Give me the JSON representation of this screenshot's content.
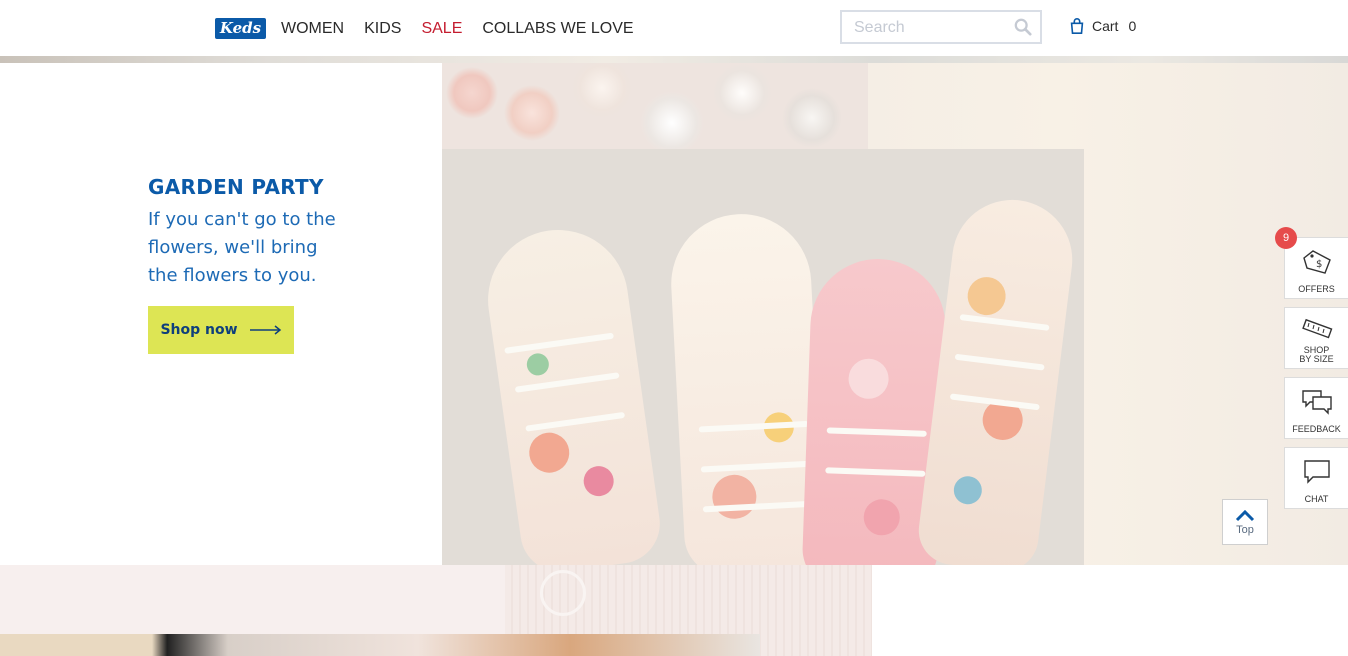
{
  "header": {
    "logo_text": "Keds",
    "nav": [
      "WOMEN",
      "KIDS",
      "SALE",
      "COLLABS WE LOVE"
    ],
    "search_placeholder": "Search",
    "cart_label": "Cart",
    "cart_count": "0"
  },
  "hero": {
    "title": "GARDEN PARTY",
    "subtitle": "If you can't go to the flowers, we'll bring the flowers to you.",
    "cta_label": "Shop now"
  },
  "widgets": {
    "offers_badge": "9",
    "offers_label": "OFFERS",
    "shop_by_size_line1": "SHOP",
    "shop_by_size_line2": "BY SIZE",
    "feedback_label": "FEEDBACK",
    "chat_label": "CHAT"
  },
  "back_to_top_label": "Top",
  "colors": {
    "brand_blue": "#0b5aa8",
    "sale_red": "#c41c2f",
    "cta_yellow": "#dde554",
    "badge_red": "#e64b4b"
  }
}
